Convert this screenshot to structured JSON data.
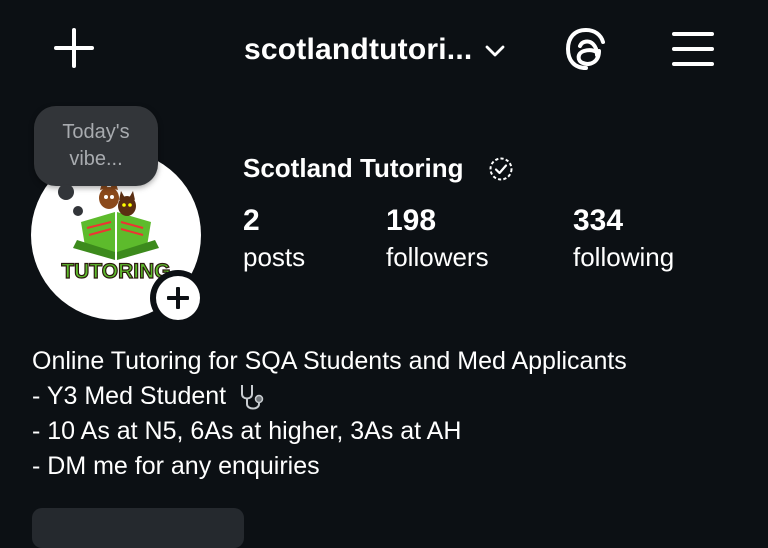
{
  "header": {
    "create_icon": "plus-icon",
    "username": "scotlandtutori...",
    "switch_icon": "chevron-down-icon",
    "threads_icon": "threads-icon",
    "menu_icon": "hamburger-menu-icon"
  },
  "note": {
    "text": "Today's vibe..."
  },
  "avatar": {
    "logo_text": "TUTORING",
    "add_icon": "plus-icon"
  },
  "profile": {
    "display_name": "Scotland Tutoring",
    "verified_icon": "verified-badge-icon"
  },
  "stats": [
    {
      "value": "2",
      "label": "posts"
    },
    {
      "value": "198",
      "label": "followers"
    },
    {
      "value": "334",
      "label": "following"
    }
  ],
  "bio": {
    "lines": [
      "Online Tutoring for SQA Students and Med Applicants",
      "- Y3 Med Student",
      "- 10 As at N5, 6As at higher, 3As at AH",
      "- DM me for any enquiries"
    ],
    "emoji_icon": "stethoscope-icon"
  },
  "colors": {
    "background": "#0c1014",
    "text": "#ffffff",
    "note_bubble": "#323539",
    "note_text": "#a8abaf",
    "logo_green": "#5dbb2c",
    "logo_orange": "#f28c28"
  }
}
